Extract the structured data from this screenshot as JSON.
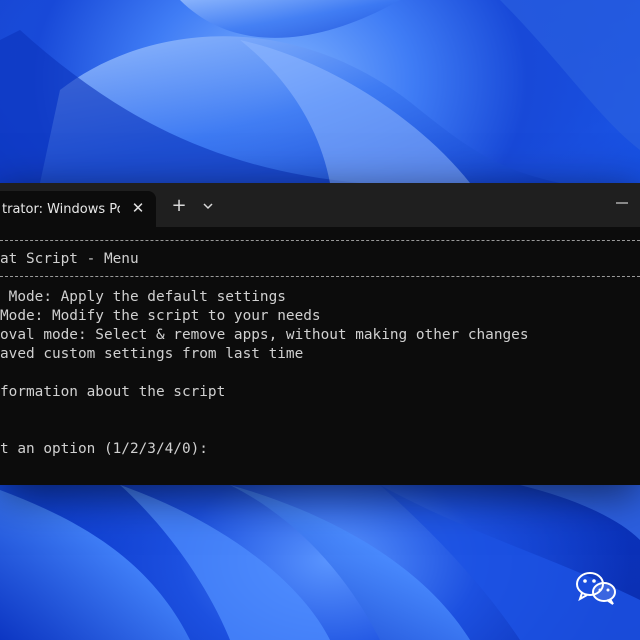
{
  "terminal": {
    "tab_title": "trator: Windows Powe",
    "close_glyph": "✕",
    "new_tab_glyph": "+",
    "dropdown_glyph": "chevron-down-icon",
    "menu_title": "at Script - Menu",
    "lines": [
      " Mode: Apply the default settings",
      "Mode: Modify the script to your needs",
      "oval mode: Select & remove apps, without making other changes",
      "aved custom settings from last time",
      "",
      "formation about the script",
      "",
      "",
      "t an option (1/2/3/4/0):"
    ]
  },
  "colors": {
    "terminal_bg": "#0c0c0c",
    "tabbar_bg": "#1f1f1f",
    "text": "#d0d0d0",
    "wallpaper_accent": "#1a55e6"
  },
  "icons": {
    "close": "close-icon",
    "new_tab": "plus-icon",
    "dropdown": "chevron-down-icon",
    "minimize": "minimize-icon",
    "watermark": "wechat-logo-icon"
  }
}
